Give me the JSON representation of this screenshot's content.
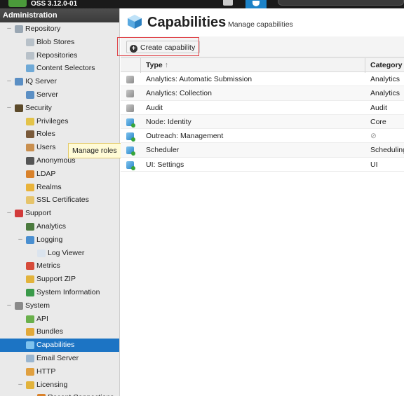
{
  "topbar": {
    "version": "OSS 3.12.0-01"
  },
  "sidebar": {
    "header": "Administration",
    "items": [
      {
        "label": "Repository",
        "level": 0,
        "toggle": "–",
        "icon": "repository-icon",
        "color": "#9aa7b3"
      },
      {
        "label": "Blob Stores",
        "level": 1,
        "icon": "blob-stores-icon",
        "color": "#b8c1c9"
      },
      {
        "label": "Repositories",
        "level": 1,
        "icon": "repositories-icon",
        "color": "#b8c1c9"
      },
      {
        "label": "Content Selectors",
        "level": 1,
        "icon": "content-selectors-icon",
        "color": "#6fa9d6"
      },
      {
        "label": "IQ Server",
        "level": 0,
        "toggle": "–",
        "icon": "iq-server-icon",
        "color": "#5b8fc4"
      },
      {
        "label": "Server",
        "level": 1,
        "icon": "server-icon",
        "color": "#5b8fc4"
      },
      {
        "label": "Security",
        "level": 0,
        "toggle": "–",
        "icon": "security-icon",
        "color": "#5c4a2a"
      },
      {
        "label": "Privileges",
        "level": 1,
        "icon": "privileges-icon",
        "color": "#e3c34a"
      },
      {
        "label": "Roles",
        "level": 1,
        "icon": "roles-icon",
        "color": "#7a5a3a"
      },
      {
        "label": "Users",
        "level": 1,
        "icon": "users-icon",
        "color": "#c98f4f"
      },
      {
        "label": "Anonymous",
        "level": 1,
        "icon": "anonymous-icon",
        "color": "#555"
      },
      {
        "label": "LDAP",
        "level": 1,
        "icon": "ldap-icon",
        "color": "#d9822b"
      },
      {
        "label": "Realms",
        "level": 1,
        "icon": "realms-icon",
        "color": "#e9b33a"
      },
      {
        "label": "SSL Certificates",
        "level": 1,
        "icon": "ssl-certificates-icon",
        "color": "#e6c46b"
      },
      {
        "label": "Support",
        "level": 0,
        "toggle": "–",
        "icon": "support-icon",
        "color": "#d23b3b"
      },
      {
        "label": "Analytics",
        "level": 1,
        "icon": "analytics-icon",
        "color": "#4b7a3e"
      },
      {
        "label": "Logging",
        "level": 1,
        "toggle": "–",
        "icon": "logging-icon",
        "color": "#4a8fd0"
      },
      {
        "label": "Log Viewer",
        "level": 2,
        "icon": "log-viewer-icon",
        "color": "#dbe4ee"
      },
      {
        "label": "Metrics",
        "level": 1,
        "icon": "metrics-icon",
        "color": "#d64b3a"
      },
      {
        "label": "Support ZIP",
        "level": 1,
        "icon": "support-zip-icon",
        "color": "#e2b33c"
      },
      {
        "label": "System Information",
        "level": 1,
        "icon": "system-information-icon",
        "color": "#3a9a4a"
      },
      {
        "label": "System",
        "level": 0,
        "toggle": "–",
        "icon": "system-icon",
        "color": "#8a8a8a"
      },
      {
        "label": "API",
        "level": 1,
        "icon": "api-icon",
        "color": "#6ab04c"
      },
      {
        "label": "Bundles",
        "level": 1,
        "icon": "bundles-icon",
        "color": "#e2a93a"
      },
      {
        "label": "Capabilities",
        "level": 1,
        "icon": "capabilities-icon",
        "color": "#7ec2ee",
        "selected": true
      },
      {
        "label": "Email Server",
        "level": 1,
        "icon": "email-server-icon",
        "color": "#9ab6d0"
      },
      {
        "label": "HTTP",
        "level": 1,
        "icon": "http-icon",
        "color": "#e0a040"
      },
      {
        "label": "Licensing",
        "level": 1,
        "toggle": "–",
        "icon": "licensing-icon",
        "color": "#e2b33c"
      },
      {
        "label": "Recent Connections",
        "level": 2,
        "icon": "recent-connections-icon",
        "color": "#d9822b"
      }
    ]
  },
  "tooltip": "Manage roles",
  "page": {
    "title": "Capabilities",
    "subtitle": "Manage capabilities",
    "create_label": "Create capability"
  },
  "table": {
    "col_type": "Type",
    "col_category": "Category",
    "rows": [
      {
        "type": "Analytics: Automatic Submission",
        "category": "Analytics",
        "icon": "grey"
      },
      {
        "type": "Analytics: Collection",
        "category": "Analytics",
        "icon": "grey"
      },
      {
        "type": "Audit",
        "category": "Audit",
        "icon": "grey"
      },
      {
        "type": "Node: Identity",
        "category": "Core",
        "icon": "blue"
      },
      {
        "type": "Outreach: Management",
        "category": "⊘",
        "icon": "blue",
        "na": true
      },
      {
        "type": "Scheduler",
        "category": "Scheduling",
        "icon": "blue"
      },
      {
        "type": "UI: Settings",
        "category": "UI",
        "icon": "blue"
      }
    ]
  }
}
